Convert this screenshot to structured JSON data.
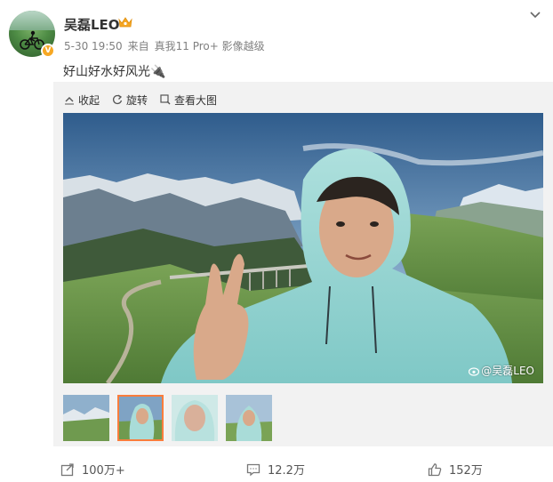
{
  "user": {
    "name": "吴磊LEO",
    "badge_icon": "crown-icon",
    "verified_icon": "verified-v-icon",
    "verified_text": "V"
  },
  "meta": {
    "time": "5-30 19:50",
    "from_label": "来自",
    "device": "真我11 Pro+ 影像越级"
  },
  "post": {
    "text": "好山好水好风光🔌"
  },
  "media_actions": {
    "collapse_label": "收起",
    "rotate_label": "旋转",
    "view_large_label": "查看大图"
  },
  "photo": {
    "watermark": "@吴磊LEO"
  },
  "thumbnails": {
    "count": 4,
    "selected_index": 1
  },
  "footer": {
    "repost_count": "100万+",
    "comment_count": "12.2万",
    "like_count": "152万"
  },
  "colors": {
    "accent": "#fa7d3c",
    "verified": "#f7a823",
    "meta_text": "#808080",
    "panel_bg": "#f2f2f2"
  }
}
